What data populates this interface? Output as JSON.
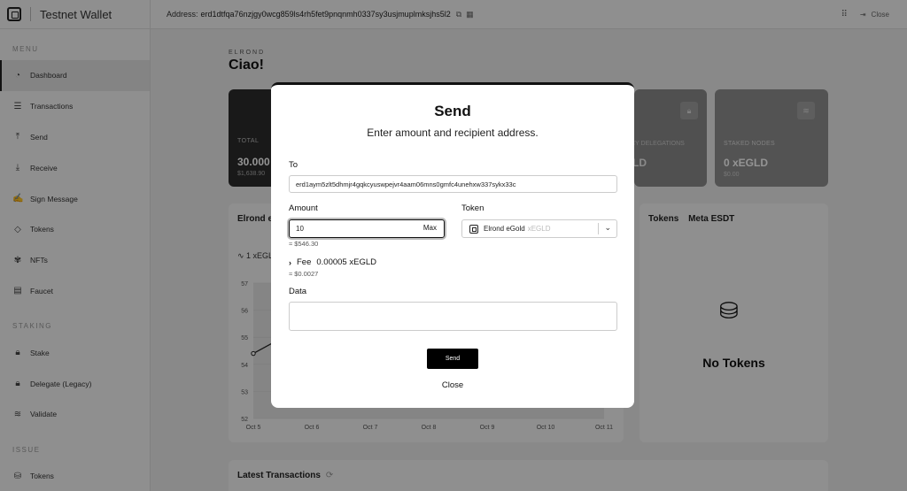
{
  "app": {
    "name": "Testnet Wallet"
  },
  "sidebar": {
    "sections": [
      {
        "title": "MENU",
        "items": [
          "Dashboard",
          "Transactions",
          "Send",
          "Receive",
          "Sign Message",
          "Tokens",
          "NFTs",
          "Faucet"
        ]
      },
      {
        "title": "STAKING",
        "items": [
          "Stake",
          "Delegate (Legacy)",
          "Validate"
        ]
      },
      {
        "title": "ISSUE",
        "items": [
          "Tokens"
        ]
      }
    ],
    "active": "Dashboard"
  },
  "topbar": {
    "address_label": "Address:",
    "address": "erd1dtfqa76nzjgy0wcg859ls4rh5fet9pnqnmh0337sy3usjmuplmksjhs5l2",
    "close_label": "Close"
  },
  "dashboard": {
    "crumb": "ELROND",
    "greeting": "Ciao!",
    "total_label": "TOTAL",
    "total_value": "30.000",
    "total_usd": "$1,638.90",
    "legacy_label": "CY DELEGATIONS",
    "legacy_value": "LD",
    "staked_label": "STAKED NODES",
    "staked_value": "0 xEGLD",
    "staked_usd": "$0.00",
    "chart_title": "Elrond e",
    "chart_sub": "1 xEGL",
    "tokens_tab": "Tokens",
    "meta_tab": "Meta ESDT",
    "no_tokens": "No Tokens",
    "latest_title": "Latest Transactions"
  },
  "chart_data": {
    "type": "line",
    "x": [
      "Oct 5",
      "Oct 6",
      "Oct 7",
      "Oct 8",
      "Oct 9",
      "Oct 10",
      "Oct 11"
    ],
    "y_ticks": [
      52,
      53,
      54,
      55,
      56,
      57
    ],
    "ylim": [
      52,
      57
    ],
    "visible_points": [
      {
        "x": "Oct 5",
        "y": 54.4
      }
    ]
  },
  "modal": {
    "title": "Send",
    "subtitle": "Enter amount and recipient address.",
    "to_label": "To",
    "to_value": "erd1aym5zlt5dhmjr4gqkcyuswpejvr4aam06mns0gmfc4unehxw337sykx33c",
    "amount_label": "Amount",
    "amount_value": "10",
    "max_label": "Max",
    "amount_usd": "≈ $546.30",
    "token_label": "Token",
    "token_name": "Elrond eGold",
    "token_ticker": "xEGLD",
    "fee_label": "Fee",
    "fee_value": "0.00005 xEGLD",
    "fee_usd": "≈ $0.0027",
    "data_label": "Data",
    "data_value": "",
    "send_label": "Send",
    "close_label": "Close"
  }
}
